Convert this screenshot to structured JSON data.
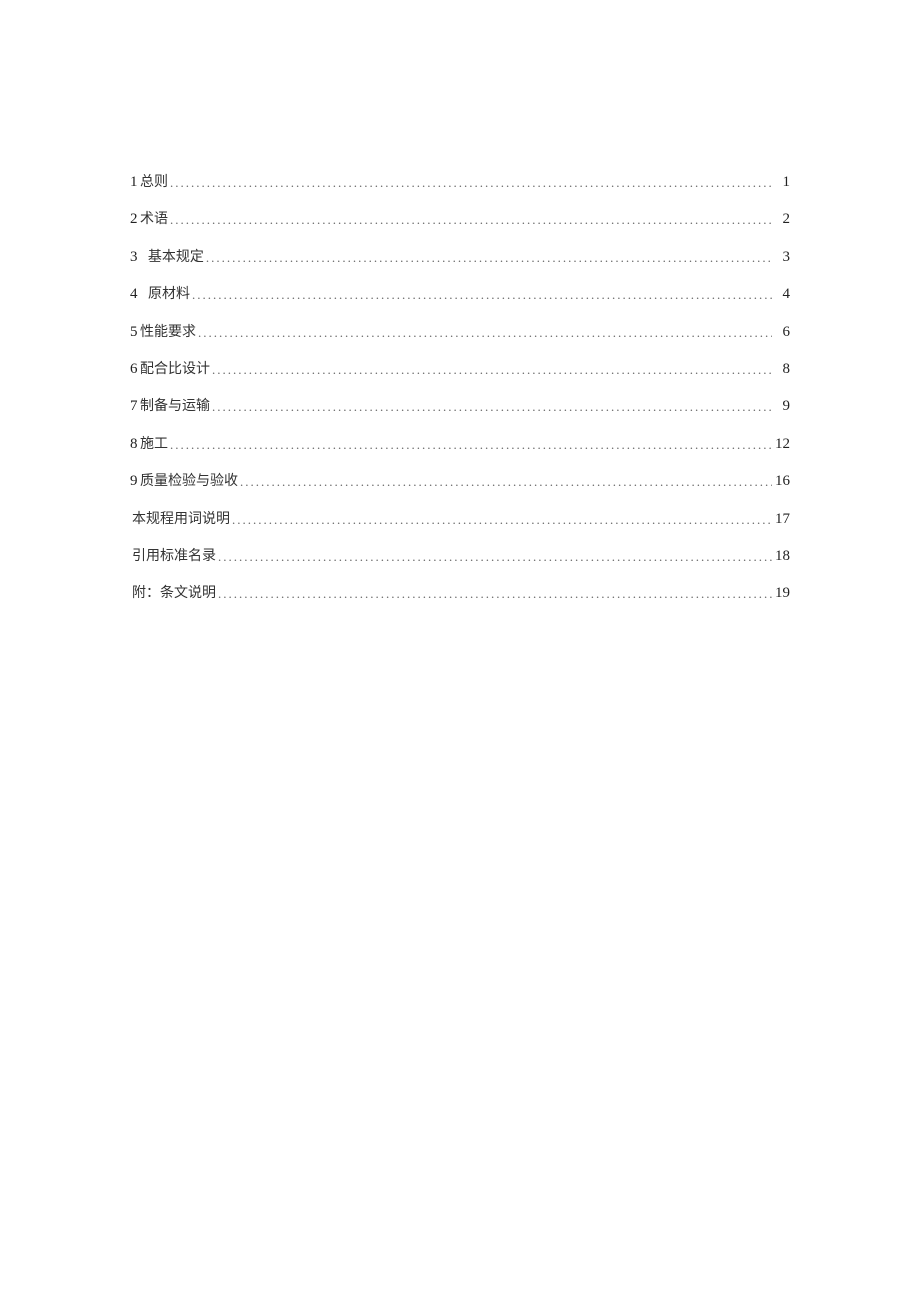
{
  "toc": {
    "entries": [
      {
        "num": "1",
        "title": "总则",
        "page": "1",
        "wide": false
      },
      {
        "num": "2",
        "title": "术语",
        "page": "2",
        "wide": false
      },
      {
        "num": "3",
        "title": "基本规定",
        "page": "3",
        "wide": true
      },
      {
        "num": "4",
        "title": "原材料",
        "page": "4",
        "wide": true
      },
      {
        "num": "5",
        "title": "性能要求",
        "page": "6",
        "wide": false
      },
      {
        "num": "6",
        "title": "配合比设计",
        "page": "8",
        "wide": false
      },
      {
        "num": "7",
        "title": "制备与运输",
        "page": "9",
        "wide": false
      },
      {
        "num": "8",
        "title": "施工",
        "page": "12",
        "wide": false
      },
      {
        "num": "9",
        "title": "质量检验与验收",
        "page": "16",
        "wide": false
      },
      {
        "num": "",
        "title": "本规程用词说明",
        "page": "17",
        "wide": false
      },
      {
        "num": "",
        "title": "引用标准名录",
        "page": "18",
        "wide": false
      },
      {
        "num": "",
        "title": "附：条文说明",
        "page": "19",
        "wide": false
      }
    ]
  }
}
